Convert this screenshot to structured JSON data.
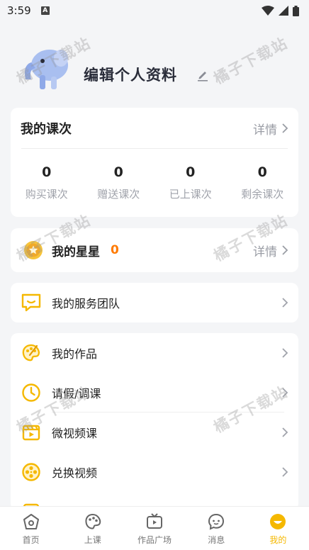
{
  "status_bar": {
    "time": "3:59",
    "notification": "A"
  },
  "profile": {
    "name": "编辑个人资料"
  },
  "lessons": {
    "title": "我的课次",
    "detail_label": "详情",
    "stats": [
      {
        "value": "0",
        "label": "购买课次"
      },
      {
        "value": "0",
        "label": "赠送课次"
      },
      {
        "value": "0",
        "label": "已上课次"
      },
      {
        "value": "0",
        "label": "剩余课次"
      }
    ]
  },
  "stars": {
    "title": "我的星星",
    "count": "0",
    "detail_label": "详情"
  },
  "service": {
    "label": "我的服务团队"
  },
  "menu": {
    "items": [
      {
        "label": "我的作品",
        "icon": "palette-icon"
      },
      {
        "label": "请假/调课",
        "icon": "clock-icon"
      },
      {
        "label": "微视频课",
        "icon": "video-clip-icon"
      },
      {
        "label": "兑换视频",
        "icon": "film-reel-icon"
      }
    ]
  },
  "tabbar": {
    "items": [
      {
        "label": "首页",
        "icon": "home-icon"
      },
      {
        "label": "上课",
        "icon": "palette-tab-icon"
      },
      {
        "label": "作品广场",
        "icon": "tv-icon"
      },
      {
        "label": "消息",
        "icon": "chat-icon"
      },
      {
        "label": "我的",
        "icon": "profile-face-icon",
        "active": true
      }
    ]
  },
  "watermark": "橘子下载站",
  "colors": {
    "accent": "#f5b800",
    "star_count": "#ff7a00",
    "muted": "#9a9da5"
  }
}
